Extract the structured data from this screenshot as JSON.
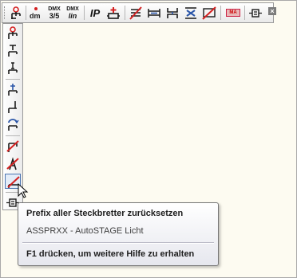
{
  "colors": {
    "icon_red": "#d42020",
    "icon_dark": "#1a1a1a",
    "icon_blue": "#2a55a8",
    "accent_border": "#4b74b0"
  },
  "toolbar_horizontal": {
    "close_glyph": "×",
    "buttons": [
      {
        "icon": "fixture-red-top-icon"
      },
      {
        "icon": "dmx-channel-icon",
        "text": "dm"
      },
      {
        "icon": "dmx-3-5-icon",
        "text_top": "DMX",
        "text_bottom": "3/5"
      },
      {
        "icon": "dmx-lin-icon",
        "text_top": "DMX",
        "text_bottom": "lin"
      },
      {
        "icon": "ip-address-icon",
        "text": "IP"
      },
      {
        "icon": "add-fixture-icon"
      },
      {
        "icon": "reset-lines-icon"
      },
      {
        "icon": "bridge-icon"
      },
      {
        "icon": "bracket-icon"
      },
      {
        "icon": "sort-blue-icon"
      },
      {
        "icon": "cancel-crossed-icon"
      },
      {
        "icon": "ma-logo-icon",
        "text": "MA"
      },
      {
        "icon": "connector-icon"
      }
    ]
  },
  "toolbar_vertical": {
    "buttons": [
      {
        "icon": "fixture-red-top-icon"
      },
      {
        "icon": "fixture-t-icon"
      },
      {
        "icon": "fixture-i-icon"
      },
      {
        "icon": "fixture-plus-icon"
      },
      {
        "icon": "fixture-hook-icon"
      },
      {
        "icon": "fixture-rotate-icon"
      },
      {
        "icon": "fixture-struck-icon"
      },
      {
        "icon": "fixture-struck-a-icon"
      },
      {
        "icon": "reset-prefix-icon"
      },
      {
        "icon": "connector-icon"
      }
    ]
  },
  "tooltip": {
    "title": "Prefix aller Steckbretter zurücksetzen",
    "description": "ASSPRXX - AutoSTAGE Licht",
    "help": "F1 drücken, um weitere Hilfe zu erhalten"
  }
}
